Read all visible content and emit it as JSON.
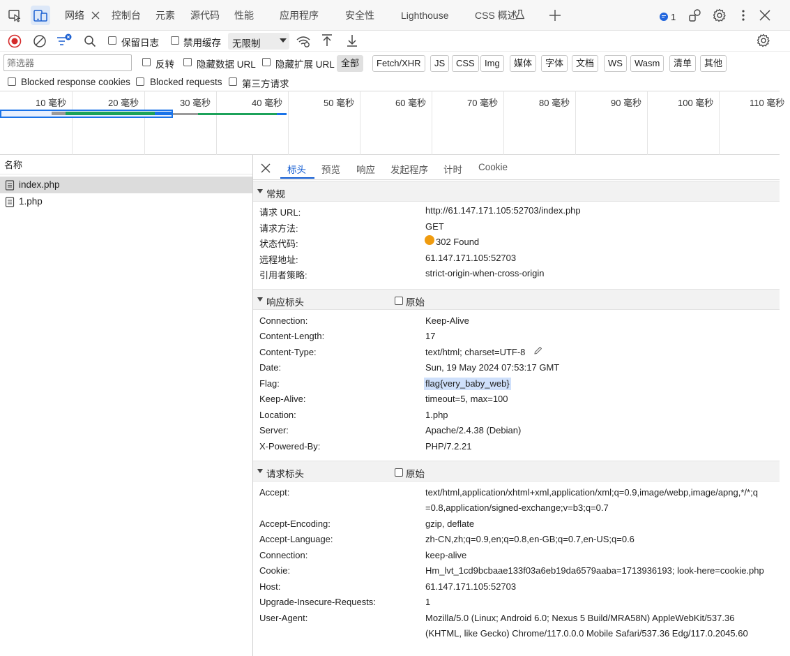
{
  "top_tabs": [
    {
      "label": "网络",
      "active": true
    },
    {
      "label": "控制台"
    },
    {
      "label": "元素"
    },
    {
      "label": "源代码"
    },
    {
      "label": "性能"
    },
    {
      "label": "应用程序"
    },
    {
      "label": "安全性"
    },
    {
      "label": "Lighthouse"
    },
    {
      "label": "CSS 概述"
    }
  ],
  "issues_count": "1",
  "toolbar": {
    "preserve_log_label": "保留日志",
    "disable_cache_label": "禁用缓存",
    "throttling_value": "无限制"
  },
  "filter": {
    "placeholder": "筛选器",
    "invert_label": "反转",
    "hide_data_urls_label": "隐藏数据 URL",
    "hide_ext_urls_label": "隐藏扩展 URL",
    "types": [
      "全部",
      "Fetch/XHR",
      "JS",
      "CSS",
      "Img",
      "媒体",
      "字体",
      "文档",
      "WS",
      "Wasm",
      "清单",
      "其他"
    ],
    "blocked_cookies_label": "Blocked response cookies",
    "blocked_requests_label": "Blocked requests",
    "third_party_label": "第三方请求"
  },
  "timeline": {
    "ticks": [
      "10 毫秒",
      "20 毫秒",
      "30 毫秒",
      "40 毫秒",
      "50 毫秒",
      "60 毫秒",
      "70 毫秒",
      "80 毫秒",
      "90 毫秒",
      "100 毫秒",
      "110 毫秒"
    ]
  },
  "request_list": {
    "column_name": "名称",
    "items": [
      "index.php",
      "1.php"
    ]
  },
  "detail_tabs": [
    "标头",
    "预览",
    "响应",
    "发起程序",
    "计时",
    "Cookie"
  ],
  "general": {
    "title": "常规",
    "rows": [
      {
        "k": "请求 URL:",
        "v": "http://61.147.171.105:52703/index.php"
      },
      {
        "k": "请求方法:",
        "v": "GET"
      },
      {
        "k": "状态代码:",
        "v": "302 Found"
      },
      {
        "k": "远程地址:",
        "v": "61.147.171.105:52703"
      },
      {
        "k": "引用者策略:",
        "v": "strict-origin-when-cross-origin"
      }
    ]
  },
  "response_headers": {
    "title": "响应标头",
    "raw_label": "原始",
    "rows": [
      {
        "k": "Connection:",
        "v": "Keep-Alive"
      },
      {
        "k": "Content-Length:",
        "v": "17"
      },
      {
        "k": "Content-Type:",
        "v": "text/html; charset=UTF-8"
      },
      {
        "k": "Date:",
        "v": "Sun, 19 May 2024 07:53:17 GMT"
      },
      {
        "k": "Flag:",
        "v": "flag{very_baby_web}"
      },
      {
        "k": "Keep-Alive:",
        "v": "timeout=5, max=100"
      },
      {
        "k": "Location:",
        "v": "1.php"
      },
      {
        "k": "Server:",
        "v": "Apache/2.4.38 (Debian)"
      },
      {
        "k": "X-Powered-By:",
        "v": "PHP/7.2.21"
      }
    ]
  },
  "request_headers": {
    "title": "请求标头",
    "raw_label": "原始",
    "rows": [
      {
        "k": "Accept:",
        "v": "text/html,application/xhtml+xml,application/xml;q=0.9,image/webp,image/apng,*/*;q",
        "v2": "=0.8,application/signed-exchange;v=b3;q=0.7"
      },
      {
        "k": "Accept-Encoding:",
        "v": "gzip, deflate"
      },
      {
        "k": "Accept-Language:",
        "v": "zh-CN,zh;q=0.9,en;q=0.8,en-GB;q=0.7,en-US;q=0.6"
      },
      {
        "k": "Connection:",
        "v": "keep-alive"
      },
      {
        "k": "Cookie:",
        "v": "Hm_lvt_1cd9bcbaae133f03a6eb19da6579aaba=1713936193; look-here=cookie.php"
      },
      {
        "k": "Host:",
        "v": "61.147.171.105:52703"
      },
      {
        "k": "Upgrade-Insecure-Requests:",
        "v": "1"
      },
      {
        "k": "User-Agent:",
        "v": "Mozilla/5.0 (Linux; Android 6.0; Nexus 5 Build/MRA58N) AppleWebKit/537.36",
        "v2": "(KHTML, like Gecko) Chrome/117.0.0.0 Mobile Safari/537.36 Edg/117.0.2045.60"
      }
    ]
  }
}
